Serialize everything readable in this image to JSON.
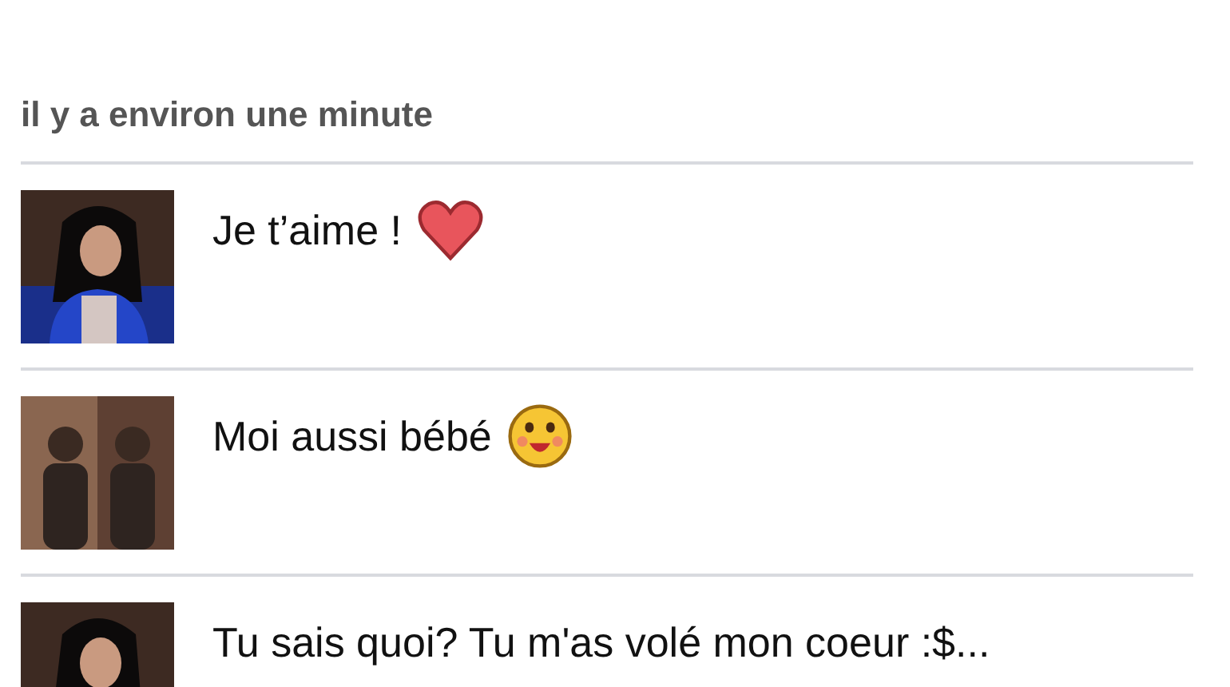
{
  "timestamp": "il y a environ une minute",
  "messages": [
    {
      "text": "Je t’aime !",
      "kind": "heart"
    },
    {
      "text": "Moi aussi bébé",
      "kind": "smiley"
    },
    {
      "text": "Tu sais quoi? Tu m'as volé mon coeur :$...",
      "kind": "plain"
    }
  ]
}
